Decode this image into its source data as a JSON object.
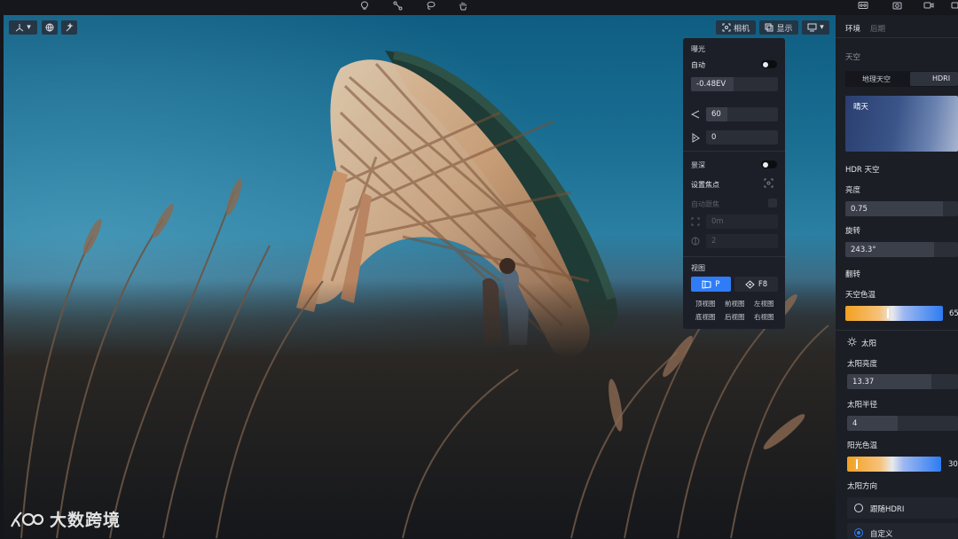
{
  "toolbar": {
    "icons": [
      "bulb-icon",
      "pen-node-icon",
      "lasso-icon",
      "hand-icon"
    ],
    "right_icons": [
      "camera-360-icon",
      "camera-icon",
      "video-icon"
    ]
  },
  "viewport": {
    "left_tools": [
      "axis-dropdown-icon",
      "globe-icon",
      "magic-icon"
    ],
    "camera_button": "相机",
    "display_button": "显示",
    "screen_icon": "screen-dropdown-icon"
  },
  "camera_panel": {
    "exposure_title": "曝光",
    "auto_label": "自动",
    "exposure_value": "-0.48EV",
    "fov_value": "60",
    "rotate_value": "0",
    "dof_label": "景深",
    "focus_label": "设置焦点",
    "auto_follow_label": "自动跟焦",
    "distance_value": "0m",
    "aperture_value": "2",
    "view_title": "视图",
    "perspective_label": "P",
    "f8_label": "F8",
    "views": [
      "顶视图",
      "前视图",
      "左视图",
      "底视图",
      "后视图",
      "右视图"
    ]
  },
  "right_panel": {
    "tabs": [
      "环境",
      "后期"
    ],
    "sky_title": "天空",
    "sky_modes": [
      "地理天空",
      "HDRI"
    ],
    "preset_name": "晴天",
    "hdr_sky_label": "HDR 天空",
    "brightness_label": "亮度",
    "brightness_value": "0.75",
    "rotation_label": "旋转",
    "rotation_value": "243.3°",
    "flip_label": "翻转",
    "sky_temp_label": "天空色温",
    "sky_temp_value": "65",
    "sun_label": "太阳",
    "sun_brightness_label": "太阳亮度",
    "sun_brightness_value": "13.37",
    "sun_radius_label": "太阳半径",
    "sun_radius_value": "4",
    "sun_temp_label": "阳光色温",
    "sun_temp_value": "30",
    "sun_direction_label": "太阳方向",
    "follow_hdri_label": "跟随HDRI",
    "custom_label": "自定义",
    "selected_direction": "自定义"
  },
  "watermark": {
    "text": "大数跨境"
  }
}
